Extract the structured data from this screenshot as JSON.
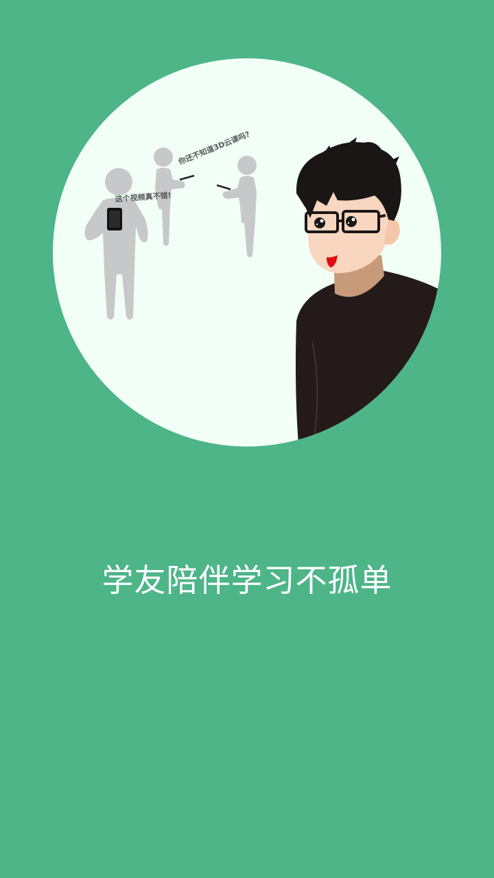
{
  "illustration": {
    "speech_1": "这个视频真不错!",
    "speech_2": "你还不知道3D云课吗?",
    "colors": {
      "background": "#4db588",
      "circle": "#f2fff6",
      "figure_gray": "#c7c8ca",
      "hair": "#1a1616",
      "skin": "#f8d6bf",
      "shirt": "#241a19"
    }
  },
  "onboarding": {
    "slogan": "学友陪伴学习不孤单"
  }
}
